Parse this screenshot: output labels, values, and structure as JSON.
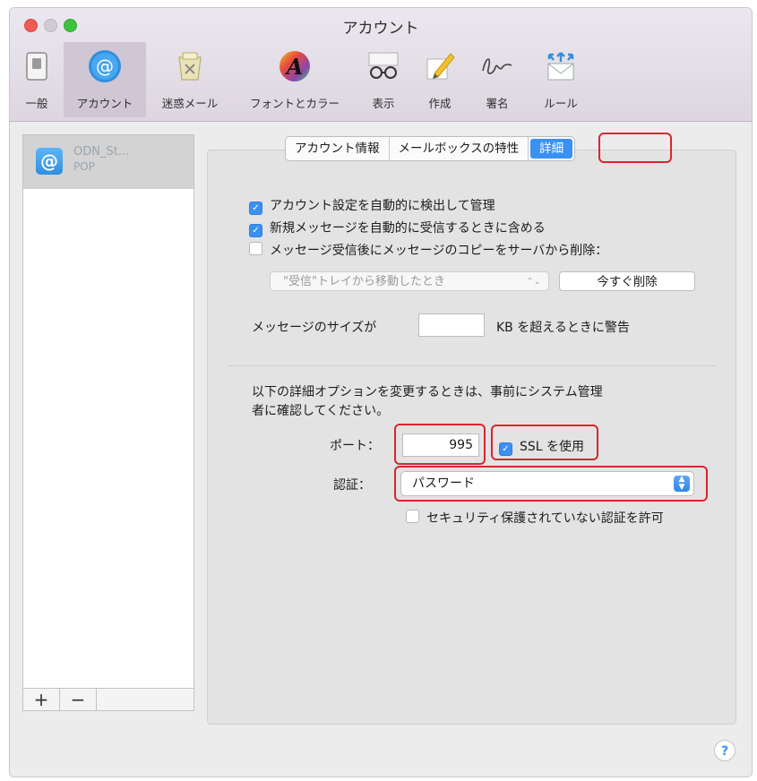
{
  "window": {
    "title": "アカウント"
  },
  "toolbar": {
    "items": [
      {
        "label": "一般",
        "icon": "switch-icon"
      },
      {
        "label": "アカウント",
        "icon": "at-icon"
      },
      {
        "label": "迷惑メール",
        "icon": "junk-trash-icon"
      },
      {
        "label": "フォントとカラー",
        "icon": "font-color-icon"
      },
      {
        "label": "表示",
        "icon": "glasses-icon"
      },
      {
        "label": "作成",
        "icon": "pencil-icon"
      },
      {
        "label": "署名",
        "icon": "signature-icon"
      },
      {
        "label": "ルール",
        "icon": "rules-envelope-icon"
      }
    ],
    "selected": "アカウント"
  },
  "accounts": {
    "items": [
      {
        "name": "ODN_St...",
        "type": "POP"
      }
    ],
    "add_label": "+",
    "remove_label": "−"
  },
  "tabs": {
    "items": [
      "アカウント情報",
      "メールボックスの特性",
      "詳細"
    ],
    "active": "詳細"
  },
  "advanced": {
    "auto_detect": {
      "label": "アカウント設定を自動的に検出して管理",
      "checked": true
    },
    "include_new": {
      "label": "新規メッセージを自動的に受信するときに含める",
      "checked": true
    },
    "delete_copy": {
      "label": "メッセージ受信後にメッセージのコピーをサーバから削除：",
      "checked": false
    },
    "delete_when": "\"受信\"トレイから移動したとき",
    "delete_now_label": "今すぐ削除",
    "size_warning_prefix": "メッセージのサイズが",
    "size_warning_value": "",
    "size_warning_suffix": "KB を超えるときに警告",
    "notice": [
      "以下の詳細オプションを変更するときは、事前にシステム管理",
      "者に確認してください。"
    ],
    "port_label": "ポート：",
    "port_value": "995",
    "ssl": {
      "label": "SSL を使用",
      "checked": true
    },
    "auth_label": "認証：",
    "auth_value": "パスワード",
    "insecure_auth": {
      "label": "セキュリティ保護されていない認証を許可",
      "checked": false
    }
  },
  "help_label": "?",
  "colors": {
    "accent": "#3b91f2",
    "highlight": "#d9262f"
  }
}
